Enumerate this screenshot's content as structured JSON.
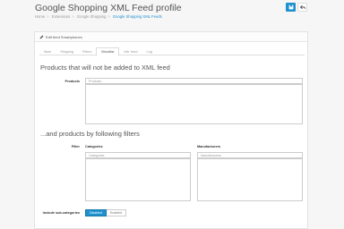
{
  "header": {
    "title": "Google Shopping XML Feed profile",
    "breadcrumb": [
      "Home",
      "Extensions",
      "Google Shopping",
      "Google Shopping XML Feeds"
    ]
  },
  "panel": {
    "heading": "Edit feed Smartphones",
    "tabs": [
      "Main",
      "Shipping",
      "Filters",
      "Blocklist",
      "Attr. feed",
      "Log"
    ],
    "active_tab": "Blocklist"
  },
  "blocklist": {
    "title": "Products that will not be added to XML feed",
    "products_label": "Products",
    "products_placeholder": "Products"
  },
  "filters": {
    "title": "...and products by following filters",
    "filter_label": "Filter",
    "categories_label": "Categories",
    "categories_placeholder": "Categories",
    "manufacturers_label": "Manufacturers",
    "manufacturers_placeholder": "Manufacturers",
    "subcat_label": "Include sub-categories",
    "toggle": {
      "on": "Disabled",
      "off": "Enabled",
      "selected": "Disabled"
    }
  },
  "colors": {
    "primary": "#1e91cf"
  },
  "icons": {
    "save": "save-icon",
    "back": "reply-icon",
    "edit": "pencil-icon"
  }
}
